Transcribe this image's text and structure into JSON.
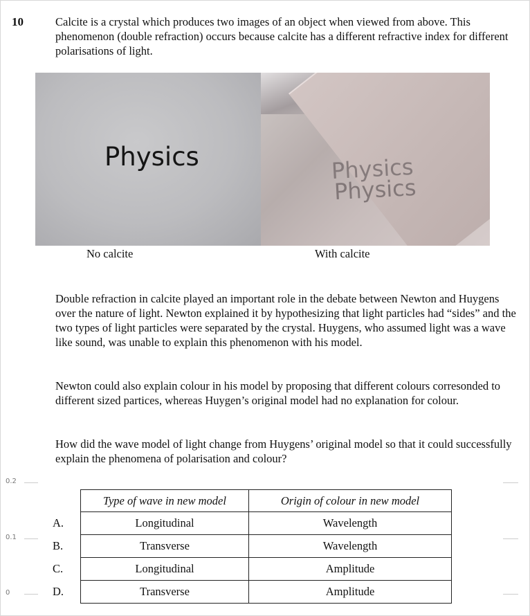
{
  "question": {
    "number": "10",
    "intro": "Calcite is a crystal which produces two images of an object when viewed from above. This phenomenon (double refraction) occurs because calcite has a different refractive index for different polarisations of light.",
    "photo_left": {
      "word": "Physics",
      "caption": "No calcite"
    },
    "photo_right": {
      "word_1": "Physics",
      "word_2": "Physics",
      "caption": "With calcite"
    },
    "paragraph_1": "Double refraction in calcite played an important role in the debate between Newton and Huygens over the nature of light. Newton explained it by hypothesizing that light particles had “sides” and the two types of light particles were separated by the crystal. Huygens, who assumed light was a wave like sound, was unable to explain this phenomenon with his model.",
    "paragraph_2": "Newton could also explain colour in his model by proposing that different colours corresonded to different sized partices, whereas Huygen’s original model had no explanation for colour.",
    "prompt": "How did the wave model of light change from Huygens’ original model so that it could successfully explain the phenomena of polarisation and colour?"
  },
  "table": {
    "headers": [
      "Type of wave in new model",
      "Origin of colour in new model"
    ],
    "rows": [
      {
        "letter": "A.",
        "wave": "Longitudinal",
        "colour": "Wavelength"
      },
      {
        "letter": "B.",
        "wave": "Transverse",
        "colour": "Wavelength"
      },
      {
        "letter": "C.",
        "wave": "Longitudinal",
        "colour": "Amplitude"
      },
      {
        "letter": "D.",
        "wave": "Transverse",
        "colour": "Amplitude"
      }
    ]
  },
  "margin_scale": [
    "0.2",
    "0.1",
    "0"
  ]
}
